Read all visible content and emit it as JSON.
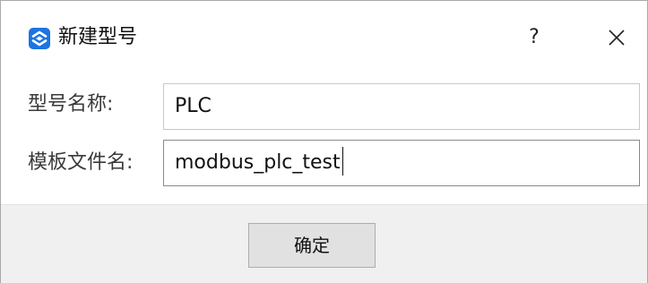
{
  "window": {
    "title": "新建型号",
    "icon": "app-logo-icon",
    "help_label": "?",
    "accent_color": "#1d74e0"
  },
  "form": {
    "model_label": "型号名称:",
    "model_value": "PLC",
    "template_label": "模板文件名:",
    "template_value": "modbus_plc_test"
  },
  "footer": {
    "ok_label": "确定"
  }
}
